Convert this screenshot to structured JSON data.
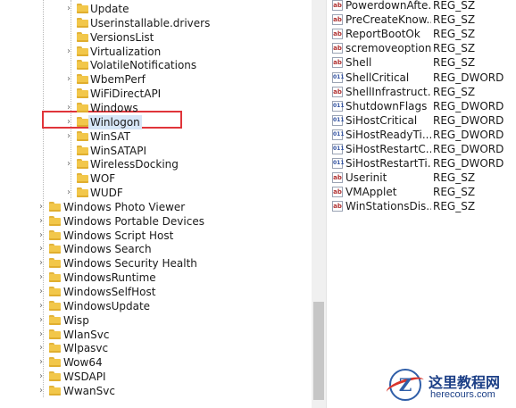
{
  "registry_tree": {
    "nested_items": [
      {
        "label": "Update",
        "expandable": true
      },
      {
        "label": "Userinstallable.drivers",
        "expandable": false
      },
      {
        "label": "VersionsList",
        "expandable": false
      },
      {
        "label": "Virtualization",
        "expandable": true
      },
      {
        "label": "VolatileNotifications",
        "expandable": false
      },
      {
        "label": "WbemPerf",
        "expandable": true
      },
      {
        "label": "WiFiDirectAPI",
        "expandable": false
      },
      {
        "label": "Windows",
        "expandable": true
      },
      {
        "label": "Winlogon",
        "expandable": true,
        "selected": true
      },
      {
        "label": "WinSAT",
        "expandable": true
      },
      {
        "label": "WinSATAPI",
        "expandable": false
      },
      {
        "label": "WirelessDocking",
        "expandable": true
      },
      {
        "label": "WOF",
        "expandable": false
      },
      {
        "label": "WUDF",
        "expandable": true
      }
    ],
    "top_items": [
      {
        "label": "Windows Photo Viewer",
        "expandable": true
      },
      {
        "label": "Windows Portable Devices",
        "expandable": true
      },
      {
        "label": "Windows Script Host",
        "expandable": true
      },
      {
        "label": "Windows Search",
        "expandable": true
      },
      {
        "label": "Windows Security Health",
        "expandable": true
      },
      {
        "label": "WindowsRuntime",
        "expandable": true
      },
      {
        "label": "WindowsSelfHost",
        "expandable": true
      },
      {
        "label": "WindowsUpdate",
        "expandable": true
      },
      {
        "label": "Wisp",
        "expandable": true
      },
      {
        "label": "WlanSvc",
        "expandable": true
      },
      {
        "label": "Wlpasvc",
        "expandable": true
      },
      {
        "label": "Wow64",
        "expandable": true
      },
      {
        "label": "WSDAPI",
        "expandable": true
      },
      {
        "label": "WwanSvc",
        "expandable": true
      }
    ]
  },
  "values_list": [
    {
      "name": "PowerdownAfte...",
      "type": "REG_SZ",
      "icon": "string-value-icon"
    },
    {
      "name": "PreCreateKnow...",
      "type": "REG_SZ",
      "icon": "string-value-icon"
    },
    {
      "name": "ReportBootOk",
      "type": "REG_SZ",
      "icon": "string-value-icon"
    },
    {
      "name": "scremoveoption",
      "type": "REG_SZ",
      "icon": "string-value-icon"
    },
    {
      "name": "Shell",
      "type": "REG_SZ",
      "icon": "string-value-icon"
    },
    {
      "name": "ShellCritical",
      "type": "REG_DWORD",
      "icon": "dword-value-icon"
    },
    {
      "name": "ShellInfrastruct...",
      "type": "REG_SZ",
      "icon": "string-value-icon"
    },
    {
      "name": "ShutdownFlags",
      "type": "REG_DWORD",
      "icon": "dword-value-icon"
    },
    {
      "name": "SiHostCritical",
      "type": "REG_DWORD",
      "icon": "dword-value-icon"
    },
    {
      "name": "SiHostReadyTi...",
      "type": "REG_DWORD",
      "icon": "dword-value-icon"
    },
    {
      "name": "SiHostRestartC...",
      "type": "REG_DWORD",
      "icon": "dword-value-icon"
    },
    {
      "name": "SiHostRestartTi...",
      "type": "REG_DWORD",
      "icon": "dword-value-icon"
    },
    {
      "name": "Userinit",
      "type": "REG_SZ",
      "icon": "string-value-icon"
    },
    {
      "name": "VMApplet",
      "type": "REG_SZ",
      "icon": "string-value-icon"
    },
    {
      "name": "WinStationsDis...",
      "type": "REG_SZ",
      "icon": "string-value-icon"
    }
  ],
  "icon_glyphs": {
    "string": "ab",
    "dword": "011"
  },
  "watermark": {
    "title": "这里教程网",
    "url": "herecours.com"
  },
  "colors": {
    "highlight_border": "#e0353a",
    "selection_bg": "#d7e6f7",
    "folder": "#f2c74a"
  }
}
